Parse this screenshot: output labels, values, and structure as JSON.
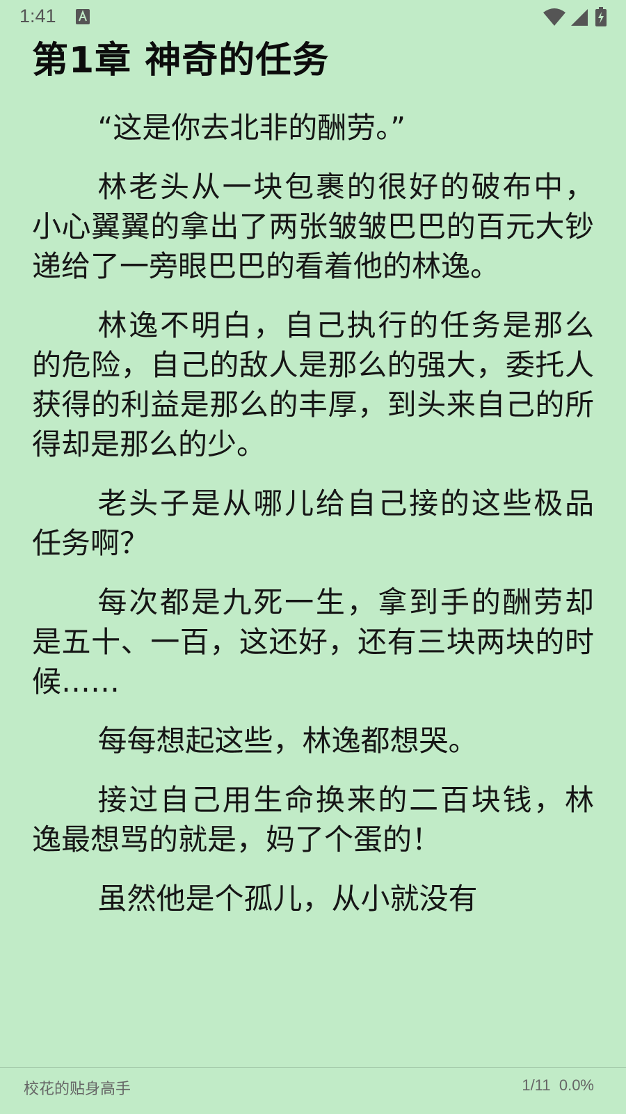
{
  "status_bar": {
    "time": "1:41",
    "icons": [
      "text-a-icon",
      "wifi-icon",
      "signal-icon",
      "battery-icon"
    ]
  },
  "reader": {
    "chapter_title": "第1章 神奇的任务",
    "paragraphs": [
      "“这是你去北非的酬劳。”",
      "林老头从一块包裹的很好的破布中，小心翼翼的拿出了两张皱皱巴巴的百元大钞递给了一旁眼巴巴的看着他的林逸。",
      "林逸不明白，自己执行的任务是那么的危险，自己的敌人是那么的强大，委托人获得的利益是那么的丰厚，到头来自己的所得却是那么的少。",
      "老头子是从哪儿给自己接的这些极品任务啊？",
      "每次都是九死一生，拿到手的酬劳却是五十、一百，这还好，还有三块两块的时候……",
      "每每想起这些，林逸都想哭。",
      "接过自己用生命换来的二百块钱，林逸最想骂的就是，妈了个蛋的！",
      "虽然他是个孤儿，从小就没有"
    ]
  },
  "footer": {
    "book_title": "校花的贴身高手",
    "page": "1/11",
    "percent": "0.0%"
  },
  "colors": {
    "background": "#c1ebc7",
    "text": "#161616",
    "footer_text": "#666666"
  }
}
